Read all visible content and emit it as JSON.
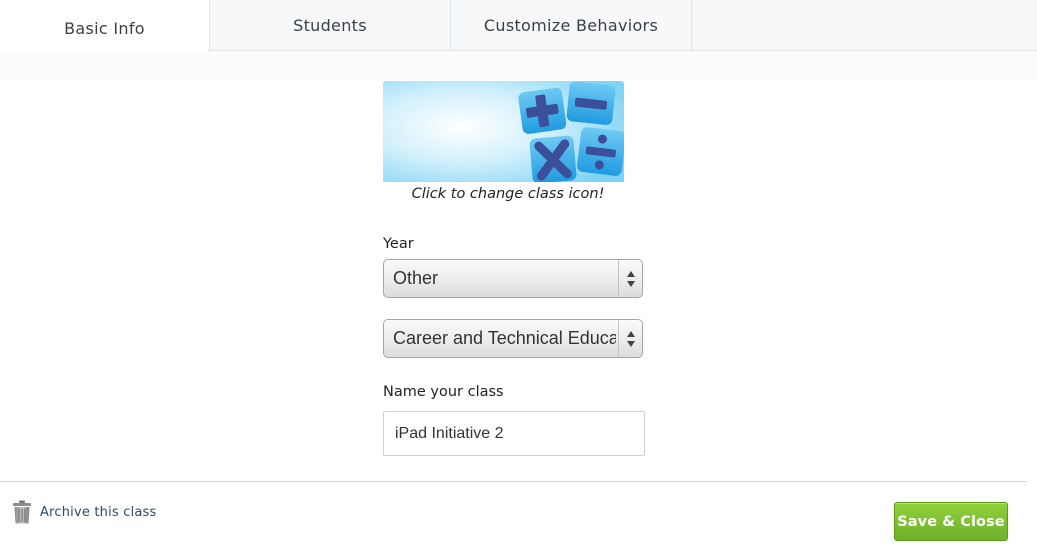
{
  "tabs": [
    {
      "label": "Basic Info",
      "active": true
    },
    {
      "label": "Students",
      "active": false
    },
    {
      "label": "Customize Behaviors",
      "active": false
    }
  ],
  "class_icon": {
    "icon": "math-symbols-icon",
    "caption": "Click to change class icon!"
  },
  "year": {
    "label": "Year",
    "selected": "Other"
  },
  "subject": {
    "selected": "Career and Technical Educa"
  },
  "class_name": {
    "label": "Name your class",
    "value": "iPad Initiative 2"
  },
  "footer": {
    "archive_label": "Archive this class",
    "archive_icon": "trash-icon",
    "save_label": "Save & Close"
  },
  "colors": {
    "save_button": "#7cc034",
    "icon_tiles": "#2fa8e6",
    "icon_symbols": "#3b4f9a"
  }
}
